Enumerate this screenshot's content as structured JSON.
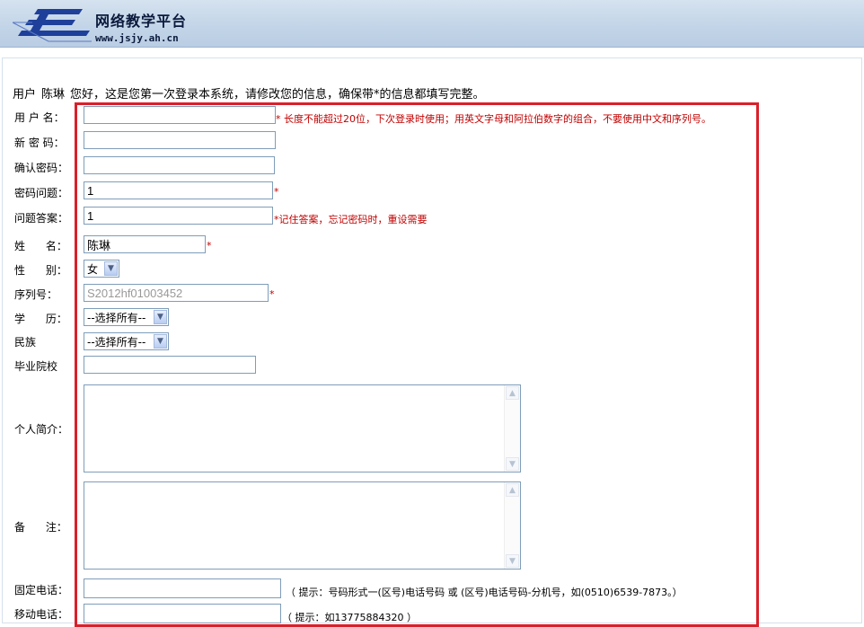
{
  "header": {
    "title": "网络教学平台",
    "url": "www.jsjy.ah.cn"
  },
  "greeting": {
    "prefix": "用户",
    "name": "陈琳",
    "message": "您好，这是您第一次登录本系统，请修改您的信息，确保带*的信息都填写完整。"
  },
  "form": {
    "username": {
      "label": "用 户 名：",
      "value": "",
      "note": "* 长度不能超过20位，下次登录时使用；用英文字母和阿拉伯数字的组合，不要使用中文和序列号。"
    },
    "new_password": {
      "label": "新 密 码：",
      "value": ""
    },
    "confirm_password": {
      "label": "确认密码：",
      "value": ""
    },
    "question": {
      "label": "密码问题：",
      "value": "1",
      "note": "*"
    },
    "answer": {
      "label": "问题答案：",
      "value": "1",
      "note": "*记住答案，忘记密码时，重设需要"
    },
    "name": {
      "label": "姓      名：",
      "value": "陈琳",
      "note": "*"
    },
    "gender": {
      "label": "性      别：",
      "value": "女"
    },
    "serial": {
      "label": "序列号：",
      "value": "S2012hf01003452",
      "note": "*"
    },
    "education": {
      "label": "学      历：",
      "value": "--选择所有--"
    },
    "ethnicity": {
      "label": "民族",
      "value": "--选择所有--"
    },
    "school": {
      "label": "毕业院校",
      "value": ""
    },
    "bio": {
      "label": "个人简介：",
      "value": ""
    },
    "remarks": {
      "label": "备      注：",
      "value": ""
    },
    "phone": {
      "label": "固定电话：",
      "value": "",
      "hint": "（ 提示：号码形式一(区号)电话号码  或  (区号)电话号码-分机号，如(0510)6539-7873。）"
    },
    "mobile": {
      "label": "移动电话：",
      "value": "",
      "hint": "（ 提示：如13775884320 ）"
    }
  },
  "colors": {
    "highlight_border": "#d9202a",
    "required_note": "#c00000",
    "header_bg": "#c3d5e8"
  }
}
